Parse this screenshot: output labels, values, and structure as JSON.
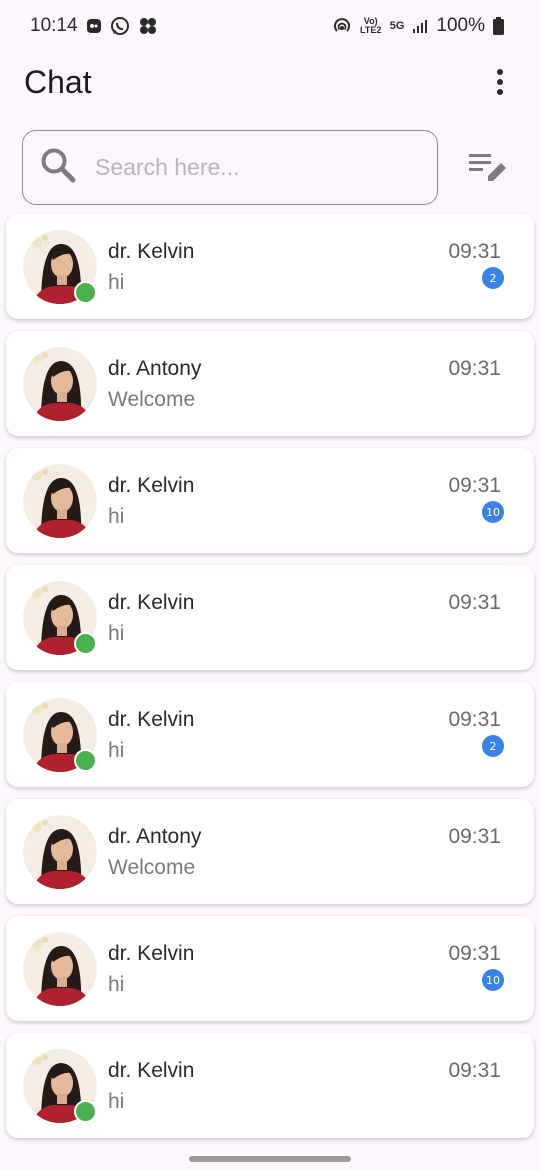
{
  "status_bar": {
    "time": "10:14",
    "battery": "100%",
    "network_label": "5G",
    "volte_label": "Vo) LTE2"
  },
  "app_bar": {
    "title": "Chat"
  },
  "search": {
    "placeholder": "Search here..."
  },
  "colors": {
    "online": "#4caf50",
    "badge": "#3b82e6",
    "background": "#fdf7fd"
  },
  "chats": [
    {
      "name": "dr. Kelvin",
      "message": "hi",
      "time": "09:31",
      "online": true,
      "unread": "2"
    },
    {
      "name": "dr. Antony",
      "message": "Welcome",
      "time": "09:31",
      "online": false,
      "unread": ""
    },
    {
      "name": "dr. Kelvin",
      "message": "hi",
      "time": "09:31",
      "online": false,
      "unread": "10"
    },
    {
      "name": "dr. Kelvin",
      "message": "hi",
      "time": "09:31",
      "online": true,
      "unread": ""
    },
    {
      "name": "dr. Kelvin",
      "message": "hi",
      "time": "09:31",
      "online": true,
      "unread": "2"
    },
    {
      "name": "dr. Antony",
      "message": "Welcome",
      "time": "09:31",
      "online": false,
      "unread": ""
    },
    {
      "name": "dr. Kelvin",
      "message": "hi",
      "time": "09:31",
      "online": false,
      "unread": "10"
    },
    {
      "name": "dr. Kelvin",
      "message": "hi",
      "time": "09:31",
      "online": true,
      "unread": ""
    }
  ]
}
